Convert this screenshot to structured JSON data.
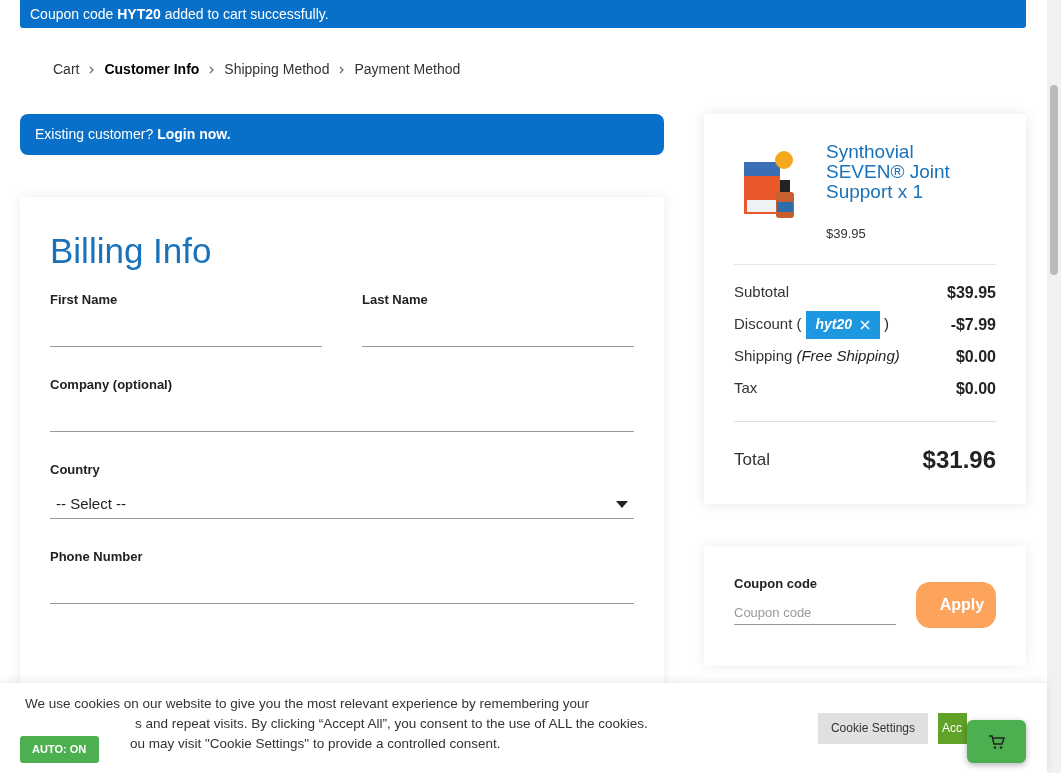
{
  "notice": "Coupon code **HYT20** added to cart successfully.",
  "breadcrumb": [
    {
      "label": "Cart",
      "selected": false
    },
    {
      "label": "Customer Info",
      "selected": true
    },
    {
      "label": "Shipping Method",
      "selected": false
    },
    {
      "label": "Payment Method",
      "selected": false
    }
  ],
  "login_banner": "Existing customer? **Login now.**",
  "billing": {
    "title": "Billing Info",
    "fields": [
      {
        "label": "First Name",
        "kind": "text",
        "half": true
      },
      {
        "label": "Last Name",
        "kind": "text",
        "half": true
      },
      {
        "label": "Company (optional)",
        "kind": "text",
        "half": false
      },
      {
        "label": "Country",
        "kind": "select",
        "value": "-- Select --",
        "half": false
      },
      {
        "label": "Phone Number",
        "kind": "text",
        "half": false
      }
    ]
  },
  "summary": {
    "product": {
      "name": "Synthovial SEVEN® Joint Support x 1",
      "price": "$39.95"
    },
    "lines": [
      {
        "label": "Subtotal",
        "value": "$39.95"
      },
      {
        "label": "Discount (",
        "coupon": "hyt20",
        "after": ")",
        "value": "-$7.99"
      },
      {
        "label": "Shipping",
        "note": "(Free Shipping)",
        "value": "$0.00"
      },
      {
        "label": "Tax",
        "value": "$0.00"
      }
    ],
    "total": {
      "label": "Total",
      "value": "$31.96"
    }
  },
  "coupon": {
    "label": "Coupon code",
    "placeholder": "Coupon code",
    "button": "Apply"
  },
  "cookie": {
    "lines": [
      "We use cookies on our website to give you the most relevant experience by remembering your",
      "s and repeat visits. By clicking “Accept All”, you consent to the use of ALL the cookies.",
      "ou may visit \"Cookie Settings\" to provide a controlled consent."
    ],
    "settings": "Cookie Settings",
    "accept": "Acc",
    "badge": "AUTO: ON"
  }
}
